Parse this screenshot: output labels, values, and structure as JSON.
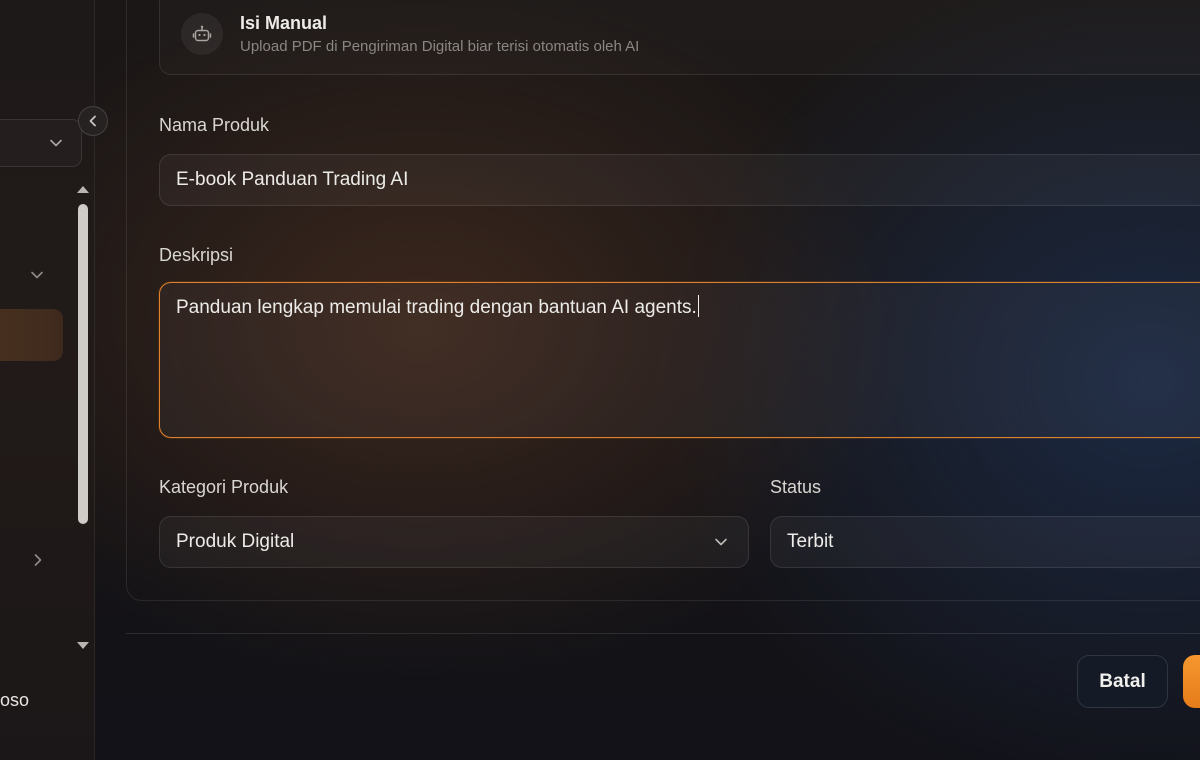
{
  "sidebar": {
    "user_label": "oso"
  },
  "manual": {
    "title": "Isi Manual",
    "subtitle": "Upload PDF di Pengiriman Digital biar terisi otomatis oleh AI",
    "icon": "robot-icon"
  },
  "form": {
    "name_label": "Nama Produk",
    "name_value": "E-book Panduan Trading AI",
    "desc_label": "Deskripsi",
    "desc_value": "Panduan lengkap memulai trading dengan bantuan AI agents.",
    "category_label": "Kategori Produk",
    "category_value": "Produk Digital",
    "status_label": "Status",
    "status_value": "Terbit"
  },
  "actions": {
    "cancel_label": "Batal",
    "save_label": ""
  },
  "colors": {
    "accent": "#f08a24",
    "focus_border": "#e0822b",
    "cancel_bg": "#141a26"
  }
}
